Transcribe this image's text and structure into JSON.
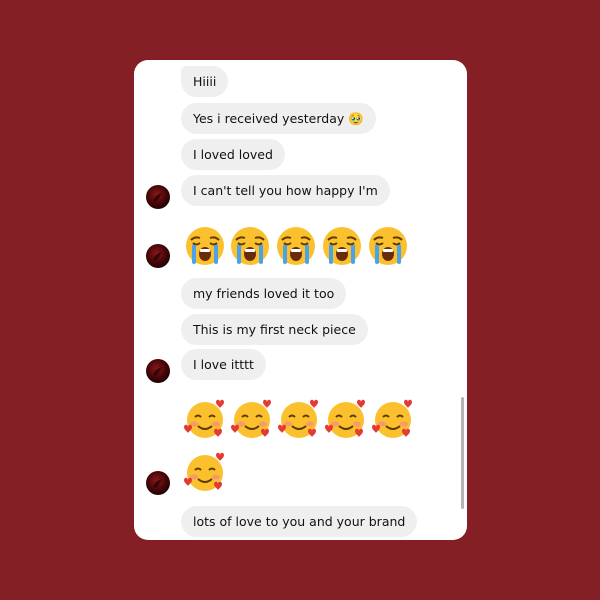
{
  "messages": [
    {
      "type": "text",
      "text": "Hiiii"
    },
    {
      "type": "text",
      "text": "Yes i received yesterday 🥹"
    },
    {
      "type": "text",
      "text": "I loved loved"
    },
    {
      "type": "text",
      "text": "I can't tell you how happy I'm"
    },
    {
      "type": "emoji",
      "icon": "loudly-crying-face",
      "count": 5
    },
    {
      "type": "text",
      "text": "my friends loved it too"
    },
    {
      "type": "text",
      "text": "This is my first neck piece"
    },
    {
      "type": "text",
      "text": "I love itttt"
    },
    {
      "type": "emoji",
      "icon": "smiling-face-with-hearts",
      "count": 6
    },
    {
      "type": "text",
      "text": "lots of love to you and your brand"
    }
  ],
  "colors": {
    "background": "#851f26",
    "card": "#ffffff",
    "bubble": "#efefef",
    "text": "#111111"
  }
}
